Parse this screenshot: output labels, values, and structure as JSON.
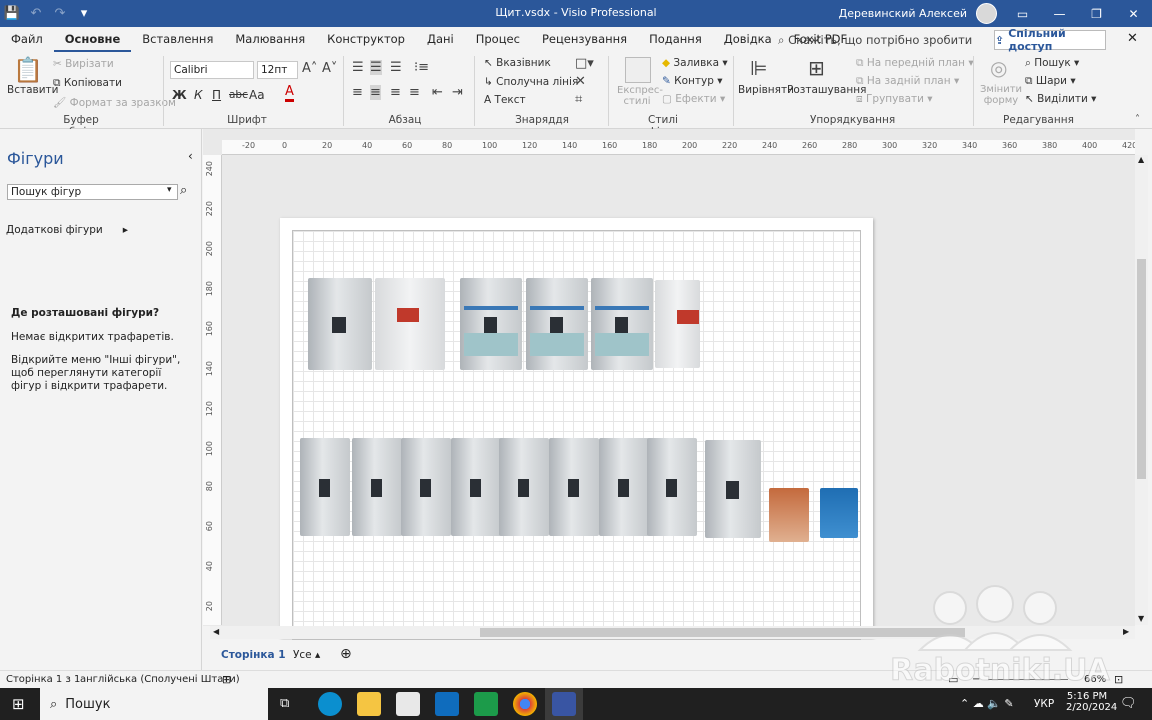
{
  "titlebar": {
    "title": "Щит.vsdx  -  Visio Professional",
    "user": "Деревинский Алексей"
  },
  "menu": {
    "tabs": [
      "Файл",
      "Основне",
      "Вставлення",
      "Малювання",
      "Конструктор",
      "Дані",
      "Процес",
      "Рецензування",
      "Подання",
      "Довідка",
      "Foxit PDF"
    ],
    "tell_me": "Скажіть, що потрібно зробити",
    "share": "Спільний доступ"
  },
  "ribbon": {
    "clipboard": {
      "paste": "Вставити",
      "cut": "Вирізати",
      "copy": "Копіювати",
      "format_painter": "Формат за зразком",
      "label": "Буфер обміну"
    },
    "font": {
      "family": "Calibri",
      "size": "12пт",
      "label": "Шрифт",
      "bold": "Ж",
      "italic": "К",
      "underline": "П",
      "strike": "abc",
      "case": "Aa"
    },
    "paragraph": {
      "label": "Абзац"
    },
    "tools": {
      "pointer": "Вказівник",
      "connector": "Сполучна лінія",
      "text": "Текст",
      "label": "Знаряддя"
    },
    "shape_styles": {
      "quick": "Експрес-стилі",
      "fill": "Заливка",
      "line": "Контур",
      "effects": "Ефекти",
      "label": "Стилі фігур"
    },
    "arrange": {
      "align": "Вирівняти",
      "position": "Розташування",
      "front": "На передній план",
      "back": "На задній план",
      "group": "Групувати",
      "label": "Упорядкування"
    },
    "editing": {
      "change_shape": "Змінити форму",
      "find": "Пошук",
      "layers": "Шари",
      "select": "Виділити",
      "label": "Редагування"
    }
  },
  "shapes_panel": {
    "title": "Фігури",
    "search_placeholder": "Пошук фігур",
    "more_shapes": "Додаткові фігури",
    "where_title": "Де розташовані фігури?",
    "no_stencils": "Немає відкритих трафаретів.",
    "hint": "Відкрийте меню \"Інші фігури\", щоб переглянути категорії фігур і відкрити трафарети."
  },
  "ruler": {
    "h_ticks": [
      "-20",
      "0",
      "20",
      "40",
      "60",
      "80",
      "100",
      "120",
      "140",
      "160",
      "180",
      "200",
      "220",
      "240",
      "260",
      "280",
      "300",
      "320",
      "340",
      "360",
      "380",
      "400",
      "420"
    ],
    "v_ticks": [
      "240",
      "220",
      "200",
      "180",
      "160",
      "140",
      "120",
      "100",
      "80",
      "60",
      "40",
      "20"
    ]
  },
  "page_tabs": {
    "page": "Сторінка 1",
    "all": "Усе"
  },
  "status": {
    "page": "Сторінка 1 з 1",
    "language": "англійська (Сполучені Штати)",
    "zoom": "66%"
  },
  "taskbar": {
    "search": "Пошук",
    "lang": "УКР",
    "time": "5:16 PM",
    "date": "2/20/2024"
  },
  "watermark": "Rabotniki.UA",
  "colors": {
    "brand": "#2b579a",
    "taskbar": "#202020"
  }
}
